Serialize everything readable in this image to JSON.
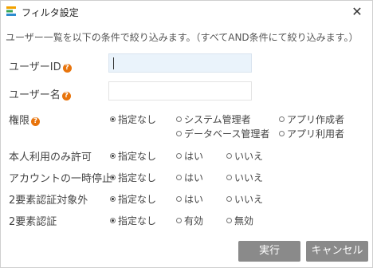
{
  "window": {
    "title": "フィルタ設定",
    "app_icon": "app-logo-icon",
    "close_glyph": "✕"
  },
  "description": "ユーザー一覧を以下の条件で絞り込みます。（すべてAND条件にて絞り込みます。）",
  "help_glyph": "?",
  "fields": {
    "user_id": {
      "label": "ユーザーID",
      "value": ""
    },
    "user_name": {
      "label": "ユーザー名",
      "value": ""
    }
  },
  "permission": {
    "label": "権限",
    "options": [
      "指定なし",
      "システム管理者",
      "アプリ作成者",
      "データベース管理者",
      "アプリ利用者"
    ],
    "selected": "指定なし"
  },
  "filters": [
    {
      "label": "本人利用のみ許可",
      "options": [
        "指定なし",
        "はい",
        "いいえ"
      ],
      "selected": "指定なし"
    },
    {
      "label": "アカウントの一時停止",
      "options": [
        "指定なし",
        "はい",
        "いいえ"
      ],
      "selected": "指定なし"
    },
    {
      "label": "2要素認証対象外",
      "options": [
        "指定なし",
        "はい",
        "いいえ"
      ],
      "selected": "指定なし"
    },
    {
      "label": "2要素認証",
      "options": [
        "指定なし",
        "有効",
        "無効"
      ],
      "selected": "指定なし"
    }
  ],
  "buttons": {
    "execute": "実行",
    "cancel": "キャンセル"
  },
  "colors": {
    "input_bg": "#eaf3fb",
    "help_badge": "#e8740c",
    "button": "#8a8a8a"
  }
}
